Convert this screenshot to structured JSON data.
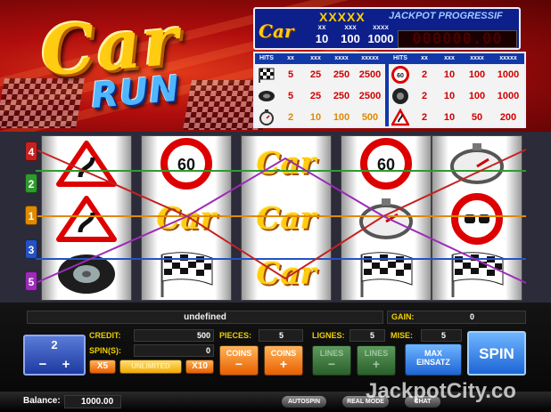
{
  "logo": {
    "line1": "Car",
    "line2": "RUN"
  },
  "jackpot": {
    "stars": "XXXXX",
    "label": "JACKPOT PROGRESSIF",
    "logo": "Car",
    "col_heads": [
      "xx",
      "xxx",
      "xxxx"
    ],
    "bets": [
      "10",
      "100",
      "1000"
    ],
    "counter": "000000.00"
  },
  "paytable": {
    "headers": [
      "HITS",
      "xx",
      "xxx",
      "xxxx",
      "xxxxx"
    ],
    "left_rows": [
      {
        "icon": "checkered-flag-icon",
        "values": [
          "5",
          "25",
          "250",
          "2500"
        ]
      },
      {
        "icon": "tire-icon",
        "values": [
          "5",
          "25",
          "250",
          "2500"
        ]
      },
      {
        "icon": "stopwatch-icon",
        "values": [
          "2",
          "10",
          "100",
          "500"
        ]
      }
    ],
    "right_rows": [
      {
        "icon": "speed-60-sign-icon",
        "values": [
          "2",
          "10",
          "100",
          "1000"
        ]
      },
      {
        "icon": "tire-icon",
        "values": [
          "2",
          "10",
          "100",
          "1000"
        ]
      },
      {
        "icon": "curve-warning-sign-icon",
        "values": [
          "2",
          "10",
          "50",
          "200"
        ]
      }
    ]
  },
  "reels": [
    [
      "curve-warning-sign-icon",
      "curve-warning-sign-icon",
      "tire-icon"
    ],
    [
      "speed-60-sign-icon",
      "car-logo-icon",
      "checkered-flag-icon"
    ],
    [
      "car-logo-icon",
      "car-logo-icon",
      "car-logo-icon"
    ],
    [
      "speed-60-sign-icon",
      "stopwatch-icon",
      "checkered-flag-icon"
    ],
    [
      "stopwatch-icon",
      "no-overtaking-sign-icon",
      "checkered-flag-icon"
    ]
  ],
  "car_logo_text": "Car",
  "line_markers": [
    {
      "num": "4",
      "color": "#c62121"
    },
    {
      "num": "2",
      "color": "#2e9b2e"
    },
    {
      "num": "1",
      "color": "#e08a00"
    },
    {
      "num": "3",
      "color": "#2452c4"
    },
    {
      "num": "5",
      "color": "#9b2bb8"
    }
  ],
  "panel": {
    "message": "undefined",
    "gain_label": "GAIN:",
    "gain_value": "0",
    "bet_value": "2",
    "bet_minus": "−",
    "bet_plus": "+",
    "credit_label": "CREDIT:",
    "credit_value": "500",
    "spins_label": "SPIN(S):",
    "spins_value": "0",
    "x5_label": "X5",
    "unlimited_label": "UNLIMITED",
    "x10_label": "X10",
    "pieces_label": "PIECES:",
    "pieces_value": "5",
    "lignes_label": "LIGNES:",
    "lignes_value": "5",
    "mise_label": "MISE:",
    "mise_value": "5",
    "coins_minus_label": "COINS",
    "coins_minus_sign": "−",
    "coins_plus_label": "COINS",
    "coins_plus_sign": "+",
    "lines_minus_label": "LINES",
    "lines_minus_sign": "−",
    "lines_plus_label": "LINES",
    "lines_plus_sign": "+",
    "max_label": "MAX",
    "max_label2": "EINSATZ",
    "spin_label": "SPIN"
  },
  "bottom": {
    "balance_label": "Balance:",
    "balance_value": "1000.00",
    "autospin": "AUTOSPIN",
    "real_mode": "REAL MODE",
    "chat": "CHAT",
    "watermark": "JackpotCity.co"
  },
  "colors": {
    "logo_yellow": "#ffcc11",
    "run_blue": "#4fb6ff",
    "panel_orange": "#e85f00",
    "spin_blue": "#1d64d6"
  }
}
